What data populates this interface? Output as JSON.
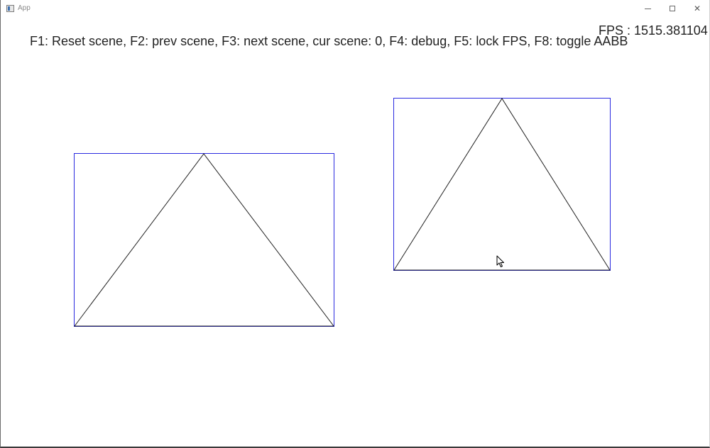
{
  "window": {
    "title": "App",
    "minimize_icon": "minimize-icon",
    "maximize_icon": "maximize-icon",
    "close_icon": "close-icon",
    "close_glyph": "✕"
  },
  "hud": {
    "controls_text": "F1: Reset scene, F2: prev scene, F3: next scene, cur scene: 0, F4: debug, F5: lock FPS, F8: toggle AABB",
    "fps_text": "FPS : 1515.381104"
  },
  "colors": {
    "aabb": "#2a2ae0",
    "triangle": "#202020",
    "background": "#ffffff"
  },
  "cursor": {
    "icon": "mouse-pointer-icon"
  }
}
